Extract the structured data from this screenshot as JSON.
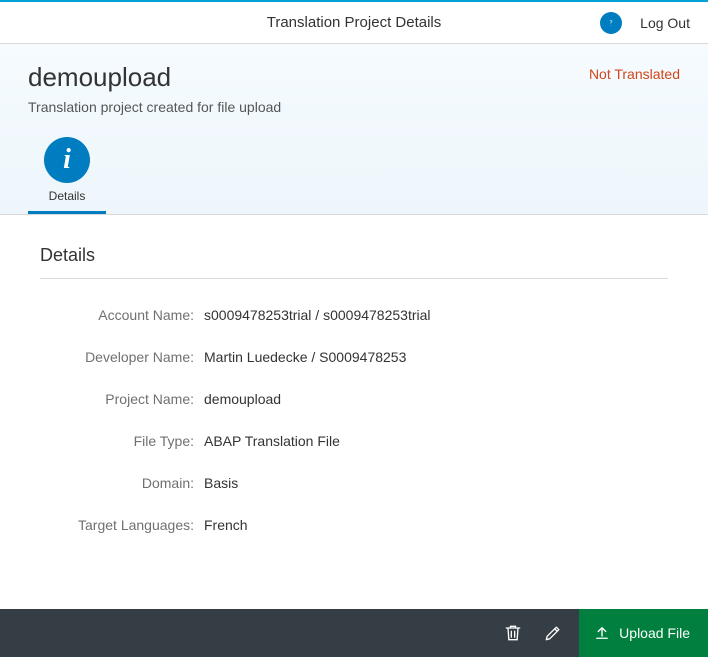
{
  "topbar": {
    "title": "Translation Project Details",
    "logout": "Log Out"
  },
  "header": {
    "title": "demoupload",
    "subtitle": "Translation project created for file upload",
    "status": "Not Translated",
    "tab_details": "Details"
  },
  "section": {
    "title": "Details"
  },
  "labels": {
    "account": "Account Name:",
    "developer": "Developer Name:",
    "project": "Project Name:",
    "filetype": "File Type:",
    "domain": "Domain:",
    "targetlang": "Target Languages:"
  },
  "values": {
    "account": "s0009478253trial / s0009478253trial",
    "developer": "Martin Luedecke / S0009478253",
    "project": "demoupload",
    "filetype": "ABAP Translation File",
    "domain": "Basis",
    "targetlang": "French"
  },
  "footer": {
    "upload": "Upload File"
  }
}
